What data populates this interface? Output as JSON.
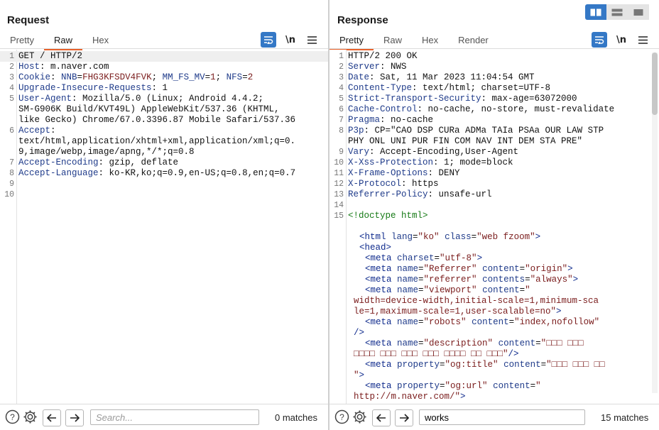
{
  "request": {
    "title": "Request",
    "tabs": [
      "Pretty",
      "Raw",
      "Hex"
    ],
    "active_tab": "Raw",
    "newline_label": "\\n",
    "search_placeholder": "Search...",
    "search_value": "",
    "matches": "0 matches",
    "lines": [
      {
        "num": "1",
        "parts": [
          [
            "plain",
            "GET / HTTP/2"
          ]
        ],
        "highlight": true
      },
      {
        "num": "2",
        "parts": [
          [
            "hn",
            "Host"
          ],
          [
            "plain",
            ": m.naver.com"
          ]
        ]
      },
      {
        "num": "3",
        "parts": [
          [
            "hn",
            "Cookie"
          ],
          [
            "plain",
            ": "
          ],
          [
            "hn",
            "NNB"
          ],
          [
            "plain",
            "="
          ],
          [
            "vr",
            "FHG3KFSDV4FVK"
          ],
          [
            "plain",
            "; "
          ],
          [
            "hn",
            "MM_FS_MV"
          ],
          [
            "plain",
            "="
          ],
          [
            "vr",
            "1"
          ],
          [
            "plain",
            "; "
          ],
          [
            "hn",
            "NFS"
          ],
          [
            "plain",
            "="
          ],
          [
            "vr",
            "2"
          ]
        ]
      },
      {
        "num": "4",
        "parts": [
          [
            "hn",
            "Upgrade-Insecure-Requests"
          ],
          [
            "plain",
            ": 1"
          ]
        ]
      },
      {
        "num": "5",
        "parts": [
          [
            "hn",
            "User-Agent"
          ],
          [
            "plain",
            ": Mozilla/5.0 (Linux; Android 4.4.2;"
          ]
        ]
      },
      {
        "num": "",
        "parts": [
          [
            "plain",
            "SM-G906K Build/KVT49L) AppleWebKit/537.36 (KHTML,"
          ]
        ]
      },
      {
        "num": "",
        "parts": [
          [
            "plain",
            "like Gecko) Chrome/67.0.3396.87 Mobile Safari/537.36"
          ]
        ]
      },
      {
        "num": "6",
        "parts": [
          [
            "hn",
            "Accept"
          ],
          [
            "plain",
            ":"
          ]
        ]
      },
      {
        "num": "",
        "parts": [
          [
            "plain",
            "text/html,application/xhtml+xml,application/xml;q=0."
          ]
        ]
      },
      {
        "num": "",
        "parts": [
          [
            "plain",
            "9,image/webp,image/apng,*/*;q=0.8"
          ]
        ]
      },
      {
        "num": "7",
        "parts": [
          [
            "hn",
            "Accept-Encoding"
          ],
          [
            "plain",
            ": gzip, deflate"
          ]
        ]
      },
      {
        "num": "8",
        "parts": [
          [
            "hn",
            "Accept-Language"
          ],
          [
            "plain",
            ": ko-KR,ko;q=0.9,en-US;q=0.8,en;q=0.7"
          ]
        ]
      },
      {
        "num": "9",
        "parts": []
      },
      {
        "num": "10",
        "parts": []
      }
    ]
  },
  "response": {
    "title": "Response",
    "tabs": [
      "Pretty",
      "Raw",
      "Hex",
      "Render"
    ],
    "active_tab": "Pretty",
    "newline_label": "\\n",
    "search_value": "works",
    "matches": "15 matches",
    "lines": [
      {
        "num": "1",
        "indent": 0,
        "parts": [
          [
            "plain",
            "HTTP/2 200 OK"
          ]
        ]
      },
      {
        "num": "2",
        "indent": 0,
        "parts": [
          [
            "hn",
            "Server"
          ],
          [
            "plain",
            ": NWS"
          ]
        ]
      },
      {
        "num": "3",
        "indent": 0,
        "parts": [
          [
            "hn",
            "Date"
          ],
          [
            "plain",
            ": Sat, 11 Mar 2023 11:04:54 GMT"
          ]
        ]
      },
      {
        "num": "4",
        "indent": 0,
        "parts": [
          [
            "hn",
            "Content-Type"
          ],
          [
            "plain",
            ": text/html; charset=UTF-8"
          ]
        ]
      },
      {
        "num": "5",
        "indent": 0,
        "parts": [
          [
            "hn",
            "Strict-Transport-Security"
          ],
          [
            "plain",
            ": max-age=63072000"
          ]
        ]
      },
      {
        "num": "6",
        "indent": 0,
        "parts": [
          [
            "hn",
            "Cache-Control"
          ],
          [
            "plain",
            ": no-cache, no-store, must-revalidate"
          ]
        ]
      },
      {
        "num": "7",
        "indent": 0,
        "parts": [
          [
            "hn",
            "Pragma"
          ],
          [
            "plain",
            ": no-cache"
          ]
        ]
      },
      {
        "num": "8",
        "indent": 0,
        "parts": [
          [
            "hn",
            "P3p"
          ],
          [
            "plain",
            ": CP=\"CAO DSP CURa ADMa TAIa PSAa OUR LAW STP"
          ]
        ]
      },
      {
        "num": "",
        "indent": 0,
        "parts": [
          [
            "plain",
            "PHY ONL UNI PUR FIN COM NAV INT DEM STA PRE\""
          ]
        ]
      },
      {
        "num": "9",
        "indent": 0,
        "parts": [
          [
            "hn",
            "Vary"
          ],
          [
            "plain",
            ": Accept-Encoding,User-Agent"
          ]
        ]
      },
      {
        "num": "10",
        "indent": 0,
        "parts": [
          [
            "hn",
            "X-Xss-Protection"
          ],
          [
            "plain",
            ": 1; mode=block"
          ]
        ]
      },
      {
        "num": "11",
        "indent": 0,
        "parts": [
          [
            "hn",
            "X-Frame-Options"
          ],
          [
            "plain",
            ": DENY"
          ]
        ]
      },
      {
        "num": "12",
        "indent": 0,
        "parts": [
          [
            "hn",
            "X-Protocol"
          ],
          [
            "plain",
            ": https"
          ]
        ]
      },
      {
        "num": "13",
        "indent": 0,
        "parts": [
          [
            "hn",
            "Referrer-Policy"
          ],
          [
            "plain",
            ": unsafe-url"
          ]
        ]
      },
      {
        "num": "14",
        "indent": 0,
        "parts": []
      },
      {
        "num": "15",
        "indent": 0,
        "parts": [
          [
            "cm",
            "<!doctype html>"
          ]
        ]
      },
      {
        "num": "",
        "indent": 0,
        "parts": []
      },
      {
        "num": "",
        "indent": 2,
        "parts": [
          [
            "tg",
            "<html "
          ],
          [
            "at",
            "lang"
          ],
          [
            "plain",
            "="
          ],
          [
            "st",
            "\"ko\""
          ],
          [
            "plain",
            " "
          ],
          [
            "at",
            "class"
          ],
          [
            "plain",
            "="
          ],
          [
            "st",
            "\"web fzoom\""
          ],
          [
            "tg",
            ">"
          ]
        ]
      },
      {
        "num": "",
        "indent": 2,
        "parts": [
          [
            "tg",
            "<head>"
          ]
        ]
      },
      {
        "num": "",
        "indent": 3,
        "parts": [
          [
            "tg",
            "<meta "
          ],
          [
            "at",
            "charset"
          ],
          [
            "plain",
            "="
          ],
          [
            "st",
            "\"utf-8\""
          ],
          [
            "tg",
            ">"
          ]
        ]
      },
      {
        "num": "",
        "indent": 3,
        "parts": [
          [
            "tg",
            "<meta "
          ],
          [
            "at",
            "name"
          ],
          [
            "plain",
            "="
          ],
          [
            "st",
            "\"Referrer\""
          ],
          [
            "plain",
            " "
          ],
          [
            "at",
            "content"
          ],
          [
            "plain",
            "="
          ],
          [
            "st",
            "\"origin\""
          ],
          [
            "tg",
            ">"
          ]
        ]
      },
      {
        "num": "",
        "indent": 3,
        "parts": [
          [
            "tg",
            "<meta "
          ],
          [
            "at",
            "name"
          ],
          [
            "plain",
            "="
          ],
          [
            "st",
            "\"referrer\""
          ],
          [
            "plain",
            " "
          ],
          [
            "at",
            "contents"
          ],
          [
            "plain",
            "="
          ],
          [
            "st",
            "\"always\""
          ],
          [
            "tg",
            ">"
          ]
        ]
      },
      {
        "num": "",
        "indent": 3,
        "parts": [
          [
            "tg",
            "<meta "
          ],
          [
            "at",
            "name"
          ],
          [
            "plain",
            "="
          ],
          [
            "st",
            "\"viewport\""
          ],
          [
            "plain",
            " "
          ],
          [
            "at",
            "content"
          ],
          [
            "plain",
            "="
          ],
          [
            "st",
            "\""
          ]
        ]
      },
      {
        "num": "",
        "indent": 1,
        "parts": [
          [
            "st",
            "width=device-width,initial-scale=1,minimum-sca"
          ]
        ]
      },
      {
        "num": "",
        "indent": 1,
        "parts": [
          [
            "st",
            "le=1,maximum-scale=1,user-scalable=no\""
          ],
          [
            "tg",
            ">"
          ]
        ]
      },
      {
        "num": "",
        "indent": 3,
        "parts": [
          [
            "tg",
            "<meta "
          ],
          [
            "at",
            "name"
          ],
          [
            "plain",
            "="
          ],
          [
            "st",
            "\"robots\""
          ],
          [
            "plain",
            " "
          ],
          [
            "at",
            "content"
          ],
          [
            "plain",
            "="
          ],
          [
            "st",
            "\"index,nofollow\""
          ]
        ]
      },
      {
        "num": "",
        "indent": 1,
        "parts": [
          [
            "tg",
            "/>"
          ]
        ]
      },
      {
        "num": "",
        "indent": 3,
        "parts": [
          [
            "tg",
            "<meta "
          ],
          [
            "at",
            "name"
          ],
          [
            "plain",
            "="
          ],
          [
            "st",
            "\"description\""
          ],
          [
            "plain",
            " "
          ],
          [
            "at",
            "content"
          ],
          [
            "plain",
            "="
          ],
          [
            "st",
            "\"□□□ □□□"
          ]
        ]
      },
      {
        "num": "",
        "indent": 1,
        "parts": [
          [
            "st",
            "□□□□ □□□ □□□ □□□ □□□□ □□ □□□\""
          ],
          [
            "tg",
            "/>"
          ]
        ]
      },
      {
        "num": "",
        "indent": 3,
        "parts": [
          [
            "tg",
            "<meta "
          ],
          [
            "at",
            "property"
          ],
          [
            "plain",
            "="
          ],
          [
            "st",
            "\"og:title\""
          ],
          [
            "plain",
            " "
          ],
          [
            "at",
            "content"
          ],
          [
            "plain",
            "="
          ],
          [
            "st",
            "\"□□□ □□□ □□"
          ]
        ]
      },
      {
        "num": "",
        "indent": 1,
        "parts": [
          [
            "st",
            "\""
          ],
          [
            "tg",
            ">"
          ]
        ]
      },
      {
        "num": "",
        "indent": 3,
        "parts": [
          [
            "tg",
            "<meta "
          ],
          [
            "at",
            "property"
          ],
          [
            "plain",
            "="
          ],
          [
            "st",
            "\"og:url\""
          ],
          [
            "plain",
            " "
          ],
          [
            "at",
            "content"
          ],
          [
            "plain",
            "="
          ],
          [
            "st",
            "\""
          ]
        ]
      },
      {
        "num": "",
        "indent": 1,
        "parts": [
          [
            "st",
            "http://m.naver.com/\""
          ],
          [
            "tg",
            ">"
          ]
        ]
      }
    ]
  }
}
